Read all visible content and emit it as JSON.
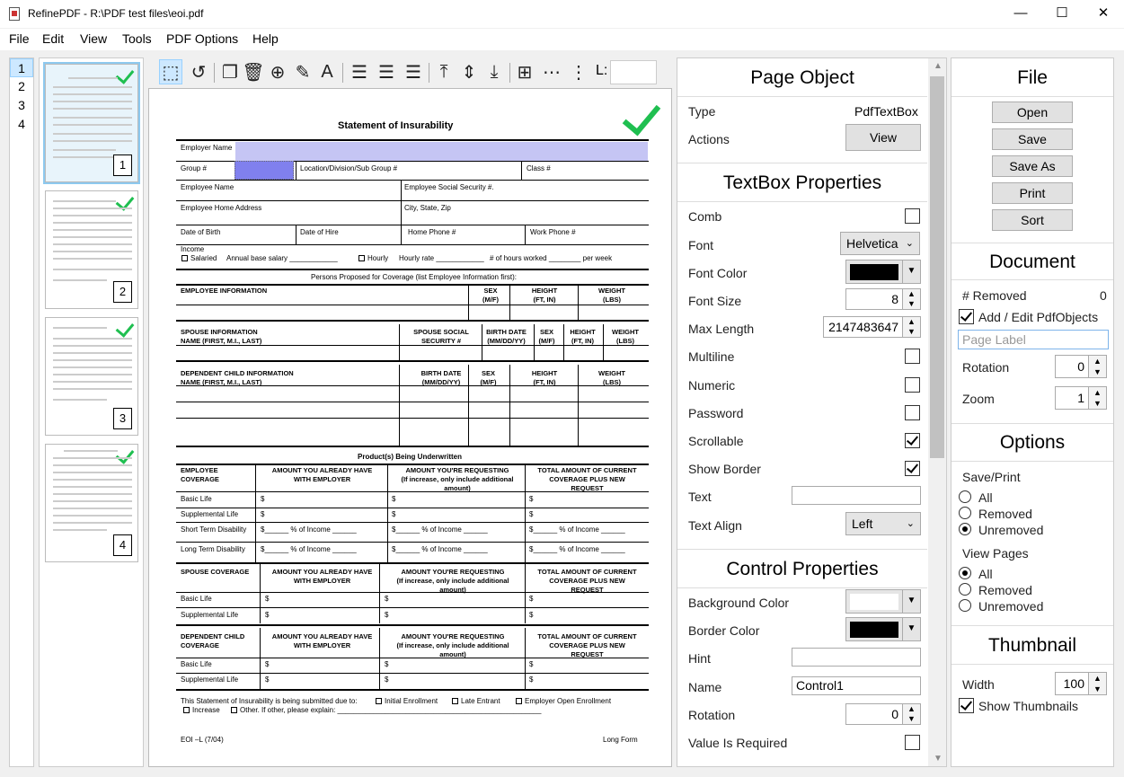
{
  "window": {
    "app_name": "RefinePDF",
    "title": "RefinePDF - R:\\PDF test files\\eoi.pdf",
    "minimize": "—",
    "maximize": "☐",
    "close": "✕"
  },
  "menu": {
    "file": "File",
    "edit": "Edit",
    "view": "View",
    "tools": "Tools",
    "pdf_options": "PDF Options",
    "help": "Help"
  },
  "page_list": [
    "1",
    "2",
    "3",
    "4"
  ],
  "thumbnails": [
    {
      "number": "1",
      "selected": true
    },
    {
      "number": "2",
      "selected": false
    },
    {
      "number": "3",
      "selected": false
    },
    {
      "number": "4",
      "selected": false
    }
  ],
  "toolbar": {
    "icons": [
      "select-icon",
      "rotate-icon",
      "copy-icon",
      "delete-icon",
      "target-icon",
      "pencil-icon",
      "text-icon",
      "align-left-icon",
      "align-center-icon",
      "align-right-icon",
      "align-top-icon",
      "align-middle-icon",
      "align-bottom-icon",
      "grid-icon",
      "distribute-h-icon",
      "distribute-v-icon"
    ],
    "layer_label": "L:"
  },
  "document": {
    "title": "Statement of Insurability",
    "employer_name": "Employer Name",
    "group": "Group #",
    "location": "Location/Division/Sub Group #",
    "class": "Class #",
    "employee_name": "Employee Name",
    "employee_ssn": "Employee Social Security #.",
    "home_address": "Employee Home Address",
    "city_state_zip": "City, State, Zip",
    "dob": "Date of Birth",
    "date_of_hire": "Date of Hire",
    "home_phone": "Home Phone #",
    "work_phone": "Work Phone #",
    "income": "Income",
    "salaried": "Salaried",
    "annual_salary": "Annual base salary ____________",
    "hourly": "Hourly",
    "hourly_rate": "Hourly rate ____________",
    "hours_worked": "# of hours worked ________ per week",
    "persons_proposed": "Persons Proposed for Coverage (list Employee Information first):",
    "employee_info": "EMPLOYEE INFORMATION",
    "sex": "SEX\n(M/F)",
    "height": "HEIGHT\n(FT, IN)",
    "weight": "WEIGHT\n(LBS)",
    "spouse_info": "SPOUSE INFORMATION\nNAME (FIRST, M.I., LAST)",
    "spouse_ssn": "SPOUSE SOCIAL\nSECURITY #",
    "birth_date": "BIRTH DATE\n(MM/DD/YY)",
    "dependent_info": "DEPENDENT CHILD INFORMATION\nNAME (FIRST, M.I., LAST)",
    "products": "Product(s) Being Underwritten",
    "employee_coverage": "EMPLOYEE\nCOVERAGE",
    "amount_have": "AMOUNT YOU ALREADY HAVE\nWITH EMPLOYER",
    "amount_requesting": "AMOUNT YOU'RE REQUESTING\n(If increase, only include additional\namount)",
    "total_amount": "TOTAL AMOUNT OF CURRENT\nCOVERAGE PLUS NEW\nREQUEST",
    "basic_life": "Basic Life",
    "supplemental_life": "Supplemental Life",
    "std": "Short Term Disability",
    "ltd": "Long Term Disability",
    "spouse_coverage": "SPOUSE COVERAGE",
    "dependent_coverage": "DEPENDENT CHILD\nCOVERAGE",
    "dollar": "$",
    "pct_income": "$______   % of Income ______",
    "submitted_due": "This Statement of Insurability is being submitted due to:",
    "initial_enrollment": "Initial Enrollment",
    "late_entrant": "Late Entrant",
    "employer_open": "Employer Open Enrollment",
    "increase": "Increase",
    "other": "Other.  If other, please explain: ___________________________________________________",
    "form_id": "EOI –L (7/04)",
    "long_form": "Long Form"
  },
  "page_object": {
    "header": "Page Object",
    "type_label": "Type",
    "type_value": "PdfTextBox",
    "actions_label": "Actions",
    "view_button": "View"
  },
  "textbox": {
    "header": "TextBox Properties",
    "comb": "Comb",
    "font": "Font",
    "font_value": "Helvetica",
    "font_color": "Font Color",
    "font_size": "Font Size",
    "font_size_value": "8",
    "max_length": "Max Length",
    "max_length_value": "2147483647",
    "multiline": "Multiline",
    "numeric": "Numeric",
    "password": "Password",
    "scrollable": "Scrollable",
    "show_border": "Show Border",
    "text": "Text",
    "text_align": "Text Align",
    "text_align_value": "Left"
  },
  "control": {
    "header": "Control Properties",
    "background_color": "Background Color",
    "border_color": "Border Color",
    "hint": "Hint",
    "name": "Name",
    "name_value": "Control1",
    "rotation": "Rotation",
    "rotation_value": "0",
    "value_required": "Value Is Required"
  },
  "file_panel": {
    "header": "File",
    "open": "Open",
    "save": "Save",
    "save_as": "Save As",
    "print": "Print",
    "sort": "Sort"
  },
  "document_panel": {
    "header": "Document",
    "removed_label": "# Removed",
    "removed_value": "0",
    "add_edit": "Add / Edit PdfObjects",
    "page_label_placeholder": "Page Label",
    "rotation": "Rotation",
    "rotation_value": "0",
    "zoom": "Zoom",
    "zoom_value": "1"
  },
  "options_panel": {
    "header": "Options",
    "save_print": "Save/Print",
    "all": "All",
    "removed": "Removed",
    "unremoved": "Unremoved",
    "view_pages": "View Pages"
  },
  "thumbnail_panel": {
    "header": "Thumbnail",
    "width": "Width",
    "width_value": "100",
    "show_thumbnails": "Show Thumbnails"
  },
  "colors": {
    "accent": "#cde8ff",
    "check_green": "#1fbf50",
    "field_highlight": "#c5c5f4",
    "selected_field": "#8080ee"
  }
}
